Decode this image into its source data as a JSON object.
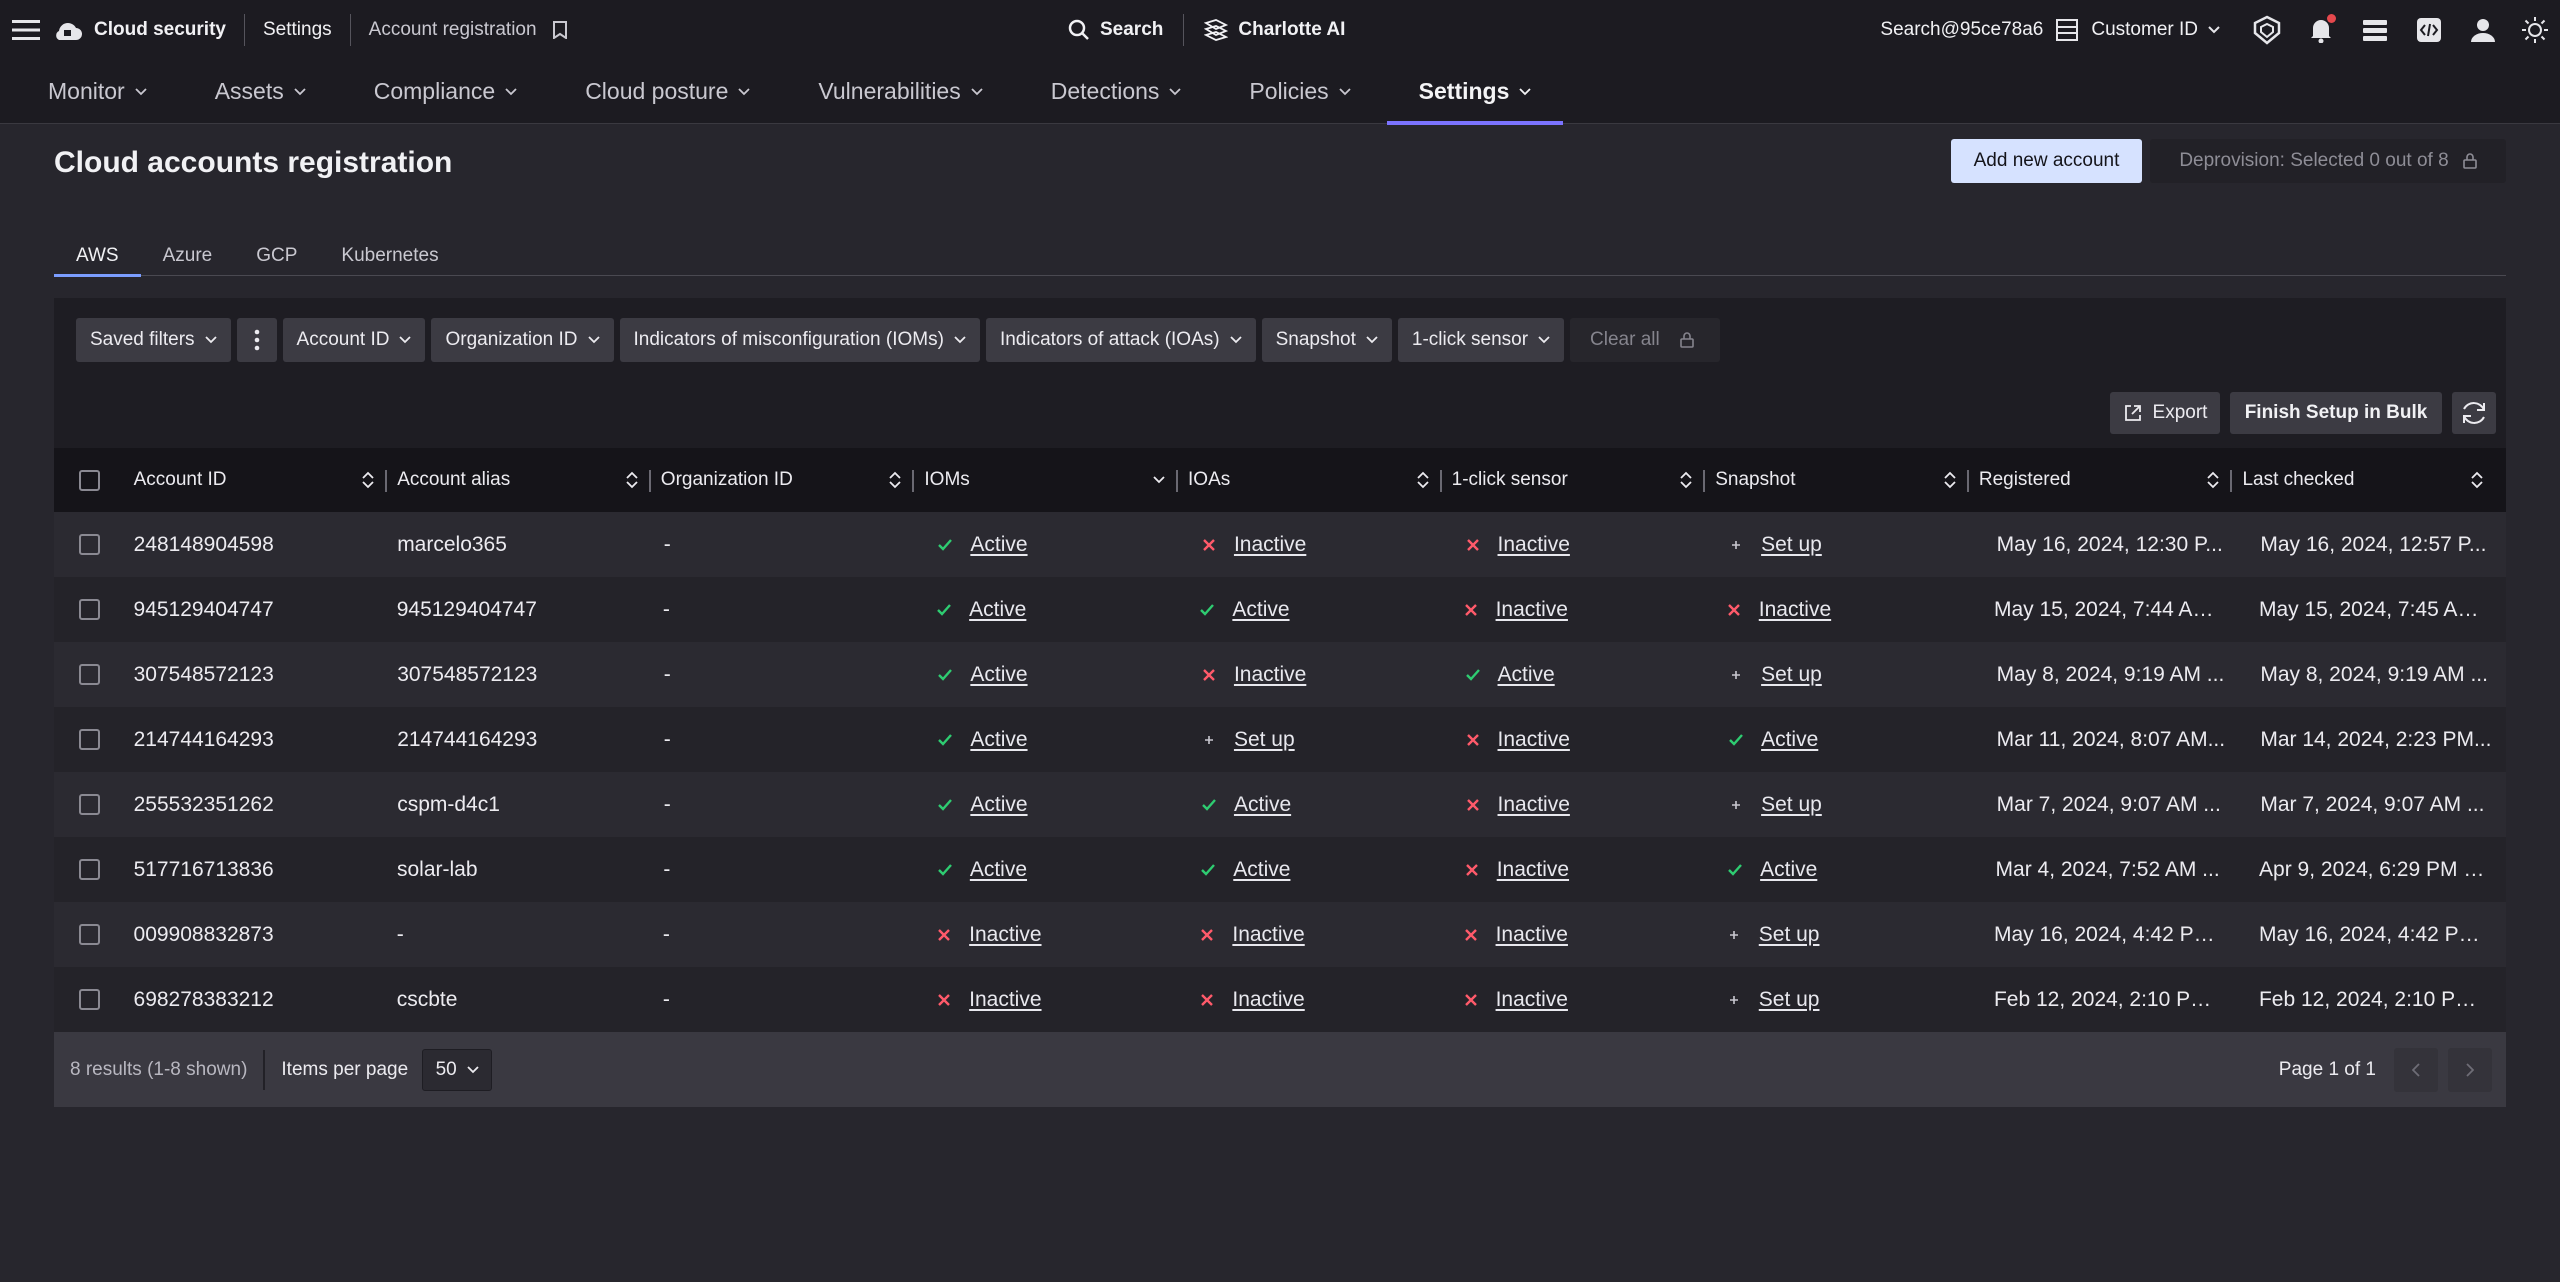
{
  "topbar": {
    "app_name": "Cloud security",
    "crumb_settings": "Settings",
    "crumb_page": "Account registration",
    "search_label": "Search",
    "charlotte_label": "Charlotte AI",
    "user_label": "Search@95ce78a6",
    "customer_label": "Customer ID"
  },
  "nav": {
    "items": [
      {
        "label": "Monitor"
      },
      {
        "label": "Assets"
      },
      {
        "label": "Compliance"
      },
      {
        "label": "Cloud posture"
      },
      {
        "label": "Vulnerabilities"
      },
      {
        "label": "Detections"
      },
      {
        "label": "Policies"
      },
      {
        "label": "Settings"
      }
    ],
    "active": "Settings"
  },
  "page": {
    "title": "Cloud accounts registration",
    "add_button": "Add new account",
    "deprovision_label": "Deprovision: Selected 0 out of 8"
  },
  "tabs": [
    "AWS",
    "Azure",
    "GCP",
    "Kubernetes"
  ],
  "filters": {
    "saved": "Saved filters",
    "chips": [
      "Account ID",
      "Organization ID",
      "Indicators of misconfiguration (IOMs)",
      "Indicators of attack (IOAs)",
      "Snapshot",
      "1-click sensor"
    ],
    "clear": "Clear all"
  },
  "toolbar": {
    "export": "Export",
    "bulk": "Finish Setup in Bulk"
  },
  "table": {
    "headers": [
      "Account ID",
      "Account alias",
      "Organization ID",
      "IOMs",
      "IOAs",
      "1-click sensor",
      "Snapshot",
      "Registered",
      "Last checked"
    ],
    "rows": [
      {
        "id": "248148904598",
        "alias": "marcelo365",
        "org": "-",
        "ioms": "Active",
        "ioas": "Inactive",
        "sensor": "Inactive",
        "snapshot": "Set up",
        "registered": "May 16, 2024, 12:30 P...",
        "checked": "May 16, 2024, 12:57 P..."
      },
      {
        "id": "945129404747",
        "alias": "945129404747",
        "org": "-",
        "ioms": "Active",
        "ioas": "Active",
        "sensor": "Inactive",
        "snapshot": "Inactive",
        "registered": "May 15, 2024, 7:44 AM...",
        "checked": "May 15, 2024, 7:45 AM..."
      },
      {
        "id": "307548572123",
        "alias": "307548572123",
        "org": "-",
        "ioms": "Active",
        "ioas": "Inactive",
        "sensor": "Active",
        "snapshot": "Set up",
        "registered": "May 8, 2024, 9:19 AM ...",
        "checked": "May 8, 2024, 9:19 AM ..."
      },
      {
        "id": "214744164293",
        "alias": "214744164293",
        "org": "-",
        "ioms": "Active",
        "ioas": "Set up",
        "sensor": "Inactive",
        "snapshot": "Active",
        "registered": "Mar 11, 2024, 8:07 AM...",
        "checked": "Mar 14, 2024, 2:23 PM..."
      },
      {
        "id": "255532351262",
        "alias": "cspm-d4c1",
        "org": "-",
        "ioms": "Active",
        "ioas": "Active",
        "sensor": "Inactive",
        "snapshot": "Set up",
        "registered": "Mar 7, 2024, 9:07 AM ...",
        "checked": "Mar 7, 2024, 9:07 AM ..."
      },
      {
        "id": "517716713836",
        "alias": "solar-lab",
        "org": "-",
        "ioms": "Active",
        "ioas": "Active",
        "sensor": "Inactive",
        "snapshot": "Active",
        "registered": "Mar 4, 2024, 7:52 AM ...",
        "checked": "Apr 9, 2024, 6:29 PM P..."
      },
      {
        "id": "009908832873",
        "alias": "-",
        "org": "-",
        "ioms": "Inactive",
        "ioas": "Inactive",
        "sensor": "Inactive",
        "snapshot": "Set up",
        "registered": "May 16, 2024, 4:42 PM...",
        "checked": "May 16, 2024, 4:42 PM..."
      },
      {
        "id": "698278383212",
        "alias": "cscbte",
        "org": "-",
        "ioms": "Inactive",
        "ioas": "Inactive",
        "sensor": "Inactive",
        "snapshot": "Set up",
        "registered": "Feb 12, 2024, 2:10 PM ...",
        "checked": "Feb 12, 2024, 2:10 PM ..."
      }
    ]
  },
  "footer": {
    "results": "8 results (1-8 shown)",
    "items_per_page_label": "Items per page",
    "items_per_page": "50",
    "page_label": "Page 1 of 1"
  },
  "colors": {
    "active": "#2ecc71",
    "inactive": "#ff5a6a",
    "setup": "#c9c8d0",
    "accent": "#7b73ff"
  }
}
